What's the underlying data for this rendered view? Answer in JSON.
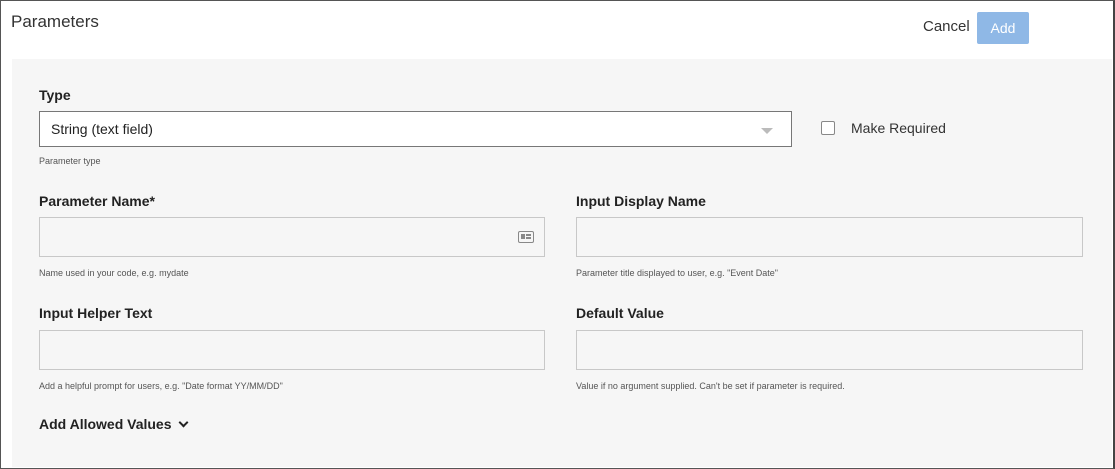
{
  "header": {
    "title": "Parameters",
    "cancel_label": "Cancel",
    "add_label": "Add"
  },
  "type_section": {
    "label": "Type",
    "selected_value": "String (text field)",
    "helper": "Parameter type",
    "make_required_label": "Make Required",
    "make_required_checked": false
  },
  "parameter_name": {
    "label": "Parameter Name*",
    "value": "",
    "helper": "Name used in your code, e.g. mydate",
    "icon": "card-icon"
  },
  "input_display_name": {
    "label": "Input Display Name",
    "value": "",
    "helper": "Parameter title displayed to user, e.g. \"Event Date\""
  },
  "input_helper_text": {
    "label": "Input Helper Text",
    "value": "",
    "helper": "Add a helpful prompt for users, e.g. \"Date format YY/MM/DD\""
  },
  "default_value": {
    "label": "Default Value",
    "value": "",
    "helper": "Value if no argument supplied. Can't be set if parameter is required."
  },
  "allowed_values": {
    "label": "Add Allowed Values",
    "icon": "chevron-down-icon"
  },
  "colors": {
    "add_button_bg": "#8fb8e6",
    "panel_bg": "#f6f6f6"
  }
}
